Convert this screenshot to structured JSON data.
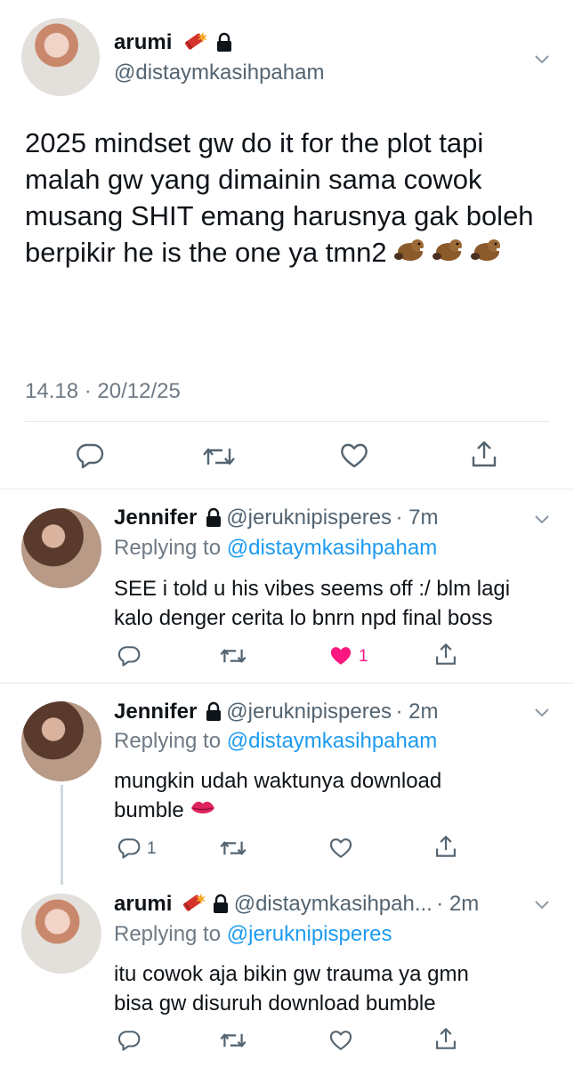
{
  "main_tweet": {
    "author_name": "arumi",
    "author_handle": "@distaymkasihpaham",
    "text": "2025 mindset gw do it for the plot tapi malah gw yang dimainin sama cowok musang SHIT emang harusnya gak boleh berpikir he is the one ya tmn2",
    "timestamp": "14.18 · 20/12/25"
  },
  "replies": [
    {
      "author_name": "Jennifer",
      "author_handle": "@jeruknipisperes",
      "time": "· 7m",
      "replying_prefix": "Replying to",
      "replying_to": "@distaymkasihpaham",
      "line1": "SEE i told u his vibes seems off :/ blm lagi",
      "line2": "kalo denger cerita lo bnrn npd final boss",
      "like_count": "1"
    },
    {
      "author_name": "Jennifer",
      "author_handle": "@jeruknipisperes",
      "time": "· 2m",
      "replying_prefix": "Replying to",
      "replying_to": "@distaymkasihpaham",
      "line1": "mungkin udah waktunya download",
      "line2": "bumble",
      "reply_count": "1"
    },
    {
      "author_name": "arumi",
      "author_handle": "@distaymkasihpah...",
      "time": "· 2m",
      "replying_prefix": "Replying to",
      "replying_to": "@jeruknipisperes",
      "line1": "itu cowok aja bikin gw trauma ya gmn",
      "line2": "bisa gw disuruh download bumble"
    }
  ],
  "colors": {
    "link": "#1d9bf0",
    "like": "#f91880",
    "muted": "#536471"
  },
  "icons": [
    "reply-icon",
    "retweet-icon",
    "like-icon",
    "share-icon",
    "lock-icon",
    "chevron-down-icon",
    "dynamite-emoji",
    "beaver-emoji",
    "lips-emoji"
  ]
}
